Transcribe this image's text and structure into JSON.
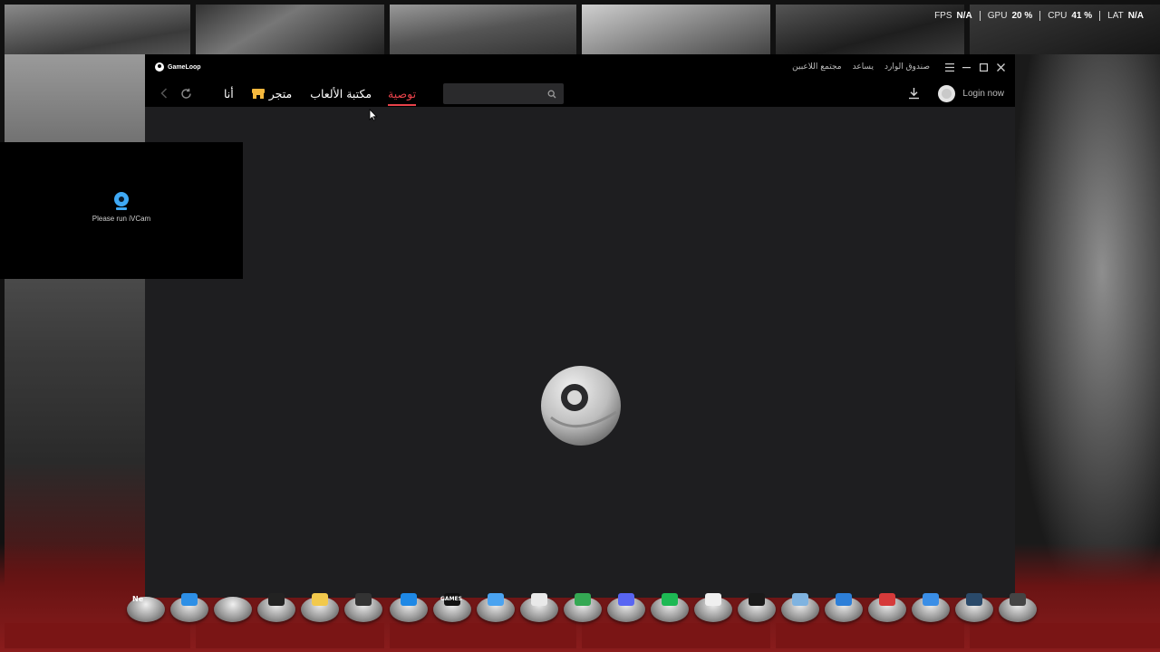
{
  "perf": {
    "fps_label": "FPS",
    "fps_value": "N/A",
    "gpu_label": "GPU",
    "gpu_value": "20 %",
    "cpu_label": "CPU",
    "cpu_value": "41 %",
    "lat_label": "LAT",
    "lat_value": "N/A"
  },
  "ivcam": {
    "message": "Please run iVCam"
  },
  "app": {
    "brand": "GameLoop",
    "title_links": [
      "صندوق الوارد",
      "يساعد",
      "مجتمع اللاعبين"
    ],
    "tabs": {
      "recommend": "توصية",
      "library": "مكتبة الألعاب",
      "store": "متجر",
      "me": "أنا"
    },
    "search": {
      "value": "",
      "placeholder": ""
    },
    "login": "Login now"
  },
  "dock": {
    "games_label": "GAMES",
    "news_label": "Ne"
  },
  "colors": {
    "accent": "#e8424a",
    "store_icon": "#f5b83d",
    "window_bg": "#1e1e20"
  }
}
